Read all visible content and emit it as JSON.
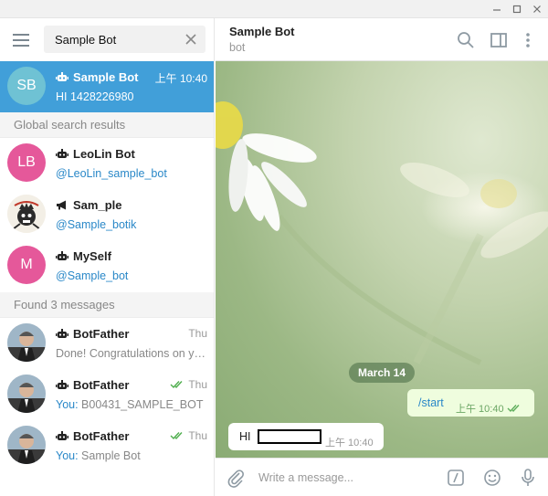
{
  "window": {
    "minimize": "—",
    "maximize": "□",
    "close": "✕"
  },
  "search": {
    "value": "Sample Bot",
    "clear_icon": "close-icon",
    "menu_icon": "hamburger-icon"
  },
  "active_chat": {
    "avatar": "SB",
    "avatar_color": "#6fc2d4",
    "name": "Sample Bot",
    "time": "上午 10:40",
    "preview": "HI  1428226980"
  },
  "global_section": "Global search results",
  "global_results": [
    {
      "avatar": "LB",
      "avatar_color": "#e5589a",
      "name": "LeoLin Bot",
      "handle": "@LeoLin_sample_bot",
      "kind": "bot"
    },
    {
      "avatar": "",
      "avatar_color": "#3a3a3a",
      "name": "Sam_ple",
      "handle": "@Sample_botik",
      "kind": "channel"
    },
    {
      "avatar": "M",
      "avatar_color": "#e5589a",
      "name": "MySelf",
      "handle": "@Sample_bot",
      "kind": "bot"
    }
  ],
  "messages_section": "Found 3 messages",
  "found_messages": [
    {
      "name": "BotFather",
      "time": "Thu",
      "prefix": "",
      "text": "Done! Congratulations on yo...",
      "read": false
    },
    {
      "name": "BotFather",
      "time": "Thu",
      "prefix": "You: ",
      "text": "B00431_SAMPLE_BOT",
      "read": true
    },
    {
      "name": "BotFather",
      "time": "Thu",
      "prefix": "You: ",
      "text": "Sample Bot",
      "read": true
    }
  ],
  "chat": {
    "title": "Sample Bot",
    "status": "bot",
    "date": "March 14",
    "outgoing": {
      "text": "/start",
      "time": "上午 10:40"
    },
    "incoming": {
      "text": "HI",
      "time": "上午 10:40"
    }
  },
  "composer": {
    "placeholder": "Write a message..."
  },
  "colors": {
    "accent": "#419fd9",
    "link": "#2a88c8",
    "check": "#4fae4e"
  }
}
